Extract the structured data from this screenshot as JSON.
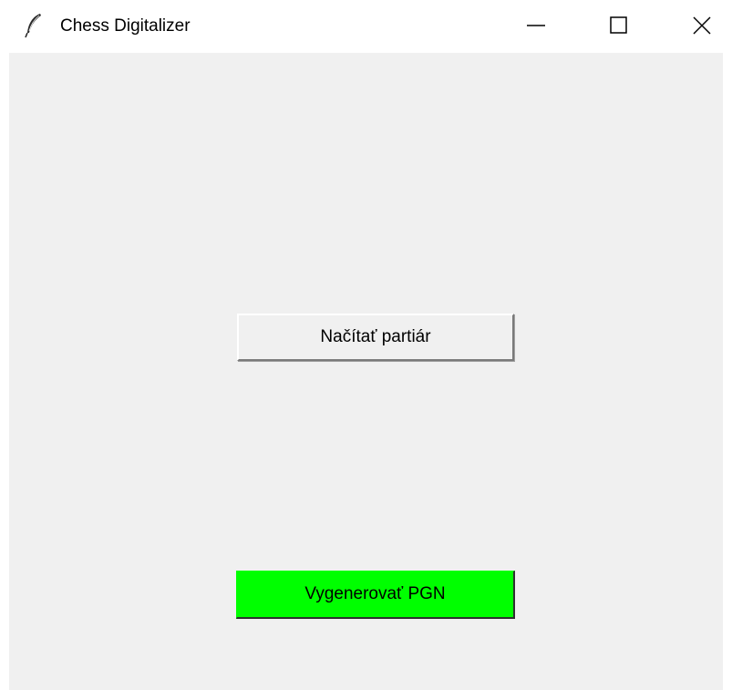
{
  "window": {
    "title": "Chess Digitalizer",
    "app_icon": "feather-icon",
    "controls": {
      "minimize_icon": "minimize-icon",
      "maximize_icon": "maximize-icon",
      "close_icon": "close-icon"
    }
  },
  "main": {
    "load_button_label": "Načítať partiár",
    "generate_button_label": "Vygenerovať PGN",
    "generate_button_color": "#00ff00",
    "background_color": "#f0f0f0"
  }
}
